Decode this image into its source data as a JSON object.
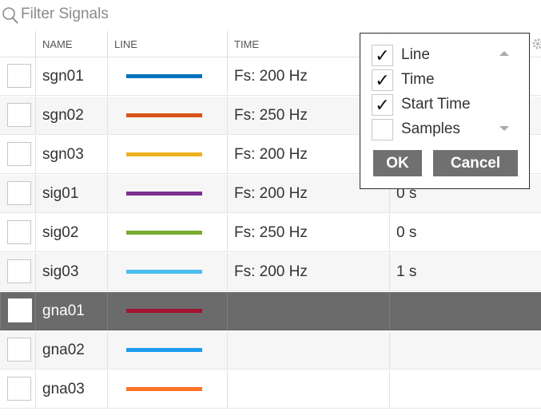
{
  "filter": {
    "placeholder": "Filter Signals",
    "value": ""
  },
  "columns": {
    "name": "NAME",
    "line": "LINE",
    "time": "TIME",
    "start": ""
  },
  "rows": [
    {
      "name": "sgn01",
      "color": "#0072BD",
      "time": "Fs: 200 Hz",
      "start": "",
      "selected": false
    },
    {
      "name": "sgn02",
      "color": "#D95319",
      "time": "Fs: 250 Hz",
      "start": "",
      "selected": false
    },
    {
      "name": "sgn03",
      "color": "#EDB120",
      "time": "Fs: 200 Hz",
      "start": "",
      "selected": false
    },
    {
      "name": "sig01",
      "color": "#7E2F8E",
      "time": "Fs: 200 Hz",
      "start": "0 s",
      "selected": false
    },
    {
      "name": "sig02",
      "color": "#77AC30",
      "time": "Fs: 250 Hz",
      "start": "0 s",
      "selected": false
    },
    {
      "name": "sig03",
      "color": "#4DBEEE",
      "time": "Fs: 200 Hz",
      "start": "1 s",
      "selected": false
    },
    {
      "name": "gna01",
      "color": "#A2142F",
      "time": "",
      "start": "",
      "selected": true
    },
    {
      "name": "gna02",
      "color": "#1E9BF0",
      "time": "",
      "start": "",
      "selected": false
    },
    {
      "name": "gna03",
      "color": "#FF7124",
      "time": "",
      "start": "",
      "selected": false
    }
  ],
  "column_popup": {
    "options": [
      {
        "label": "Line",
        "checked": true
      },
      {
        "label": "Time",
        "checked": true
      },
      {
        "label": "Start Time",
        "checked": true
      },
      {
        "label": "Samples",
        "checked": false
      }
    ],
    "ok_label": "OK",
    "cancel_label": "Cancel"
  }
}
